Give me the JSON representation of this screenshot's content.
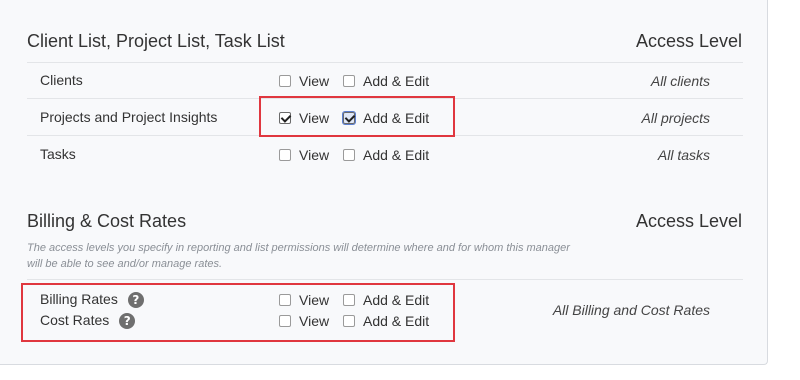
{
  "section1": {
    "title": "Client List, Project List, Task List",
    "access_header": "Access Level",
    "rows": [
      {
        "label": "Clients",
        "view": "View",
        "add_edit": "Add & Edit",
        "view_checked": false,
        "add_edit_checked": false,
        "access": "All clients"
      },
      {
        "label": "Projects and Project Insights",
        "view": "View",
        "add_edit": "Add & Edit",
        "view_checked": true,
        "add_edit_checked": true,
        "access": "All projects"
      },
      {
        "label": "Tasks",
        "view": "View",
        "add_edit": "Add & Edit",
        "view_checked": false,
        "add_edit_checked": false,
        "access": "All tasks"
      }
    ]
  },
  "section2": {
    "title": "Billing & Cost Rates",
    "access_header": "Access Level",
    "description": "The access levels you specify in reporting and list permissions will determine where and for whom this manager will be able to see and/or manage rates.",
    "rows": [
      {
        "label": "Billing Rates",
        "view": "View",
        "add_edit": "Add & Edit",
        "view_checked": false,
        "add_edit_checked": false,
        "help_icon": "question-circle-icon"
      },
      {
        "label": "Cost Rates",
        "view": "View",
        "add_edit": "Add & Edit",
        "view_checked": false,
        "add_edit_checked": false,
        "help_icon": "question-circle-icon"
      }
    ],
    "access": "All Billing and Cost Rates"
  },
  "highlight_color": "#e0373f"
}
